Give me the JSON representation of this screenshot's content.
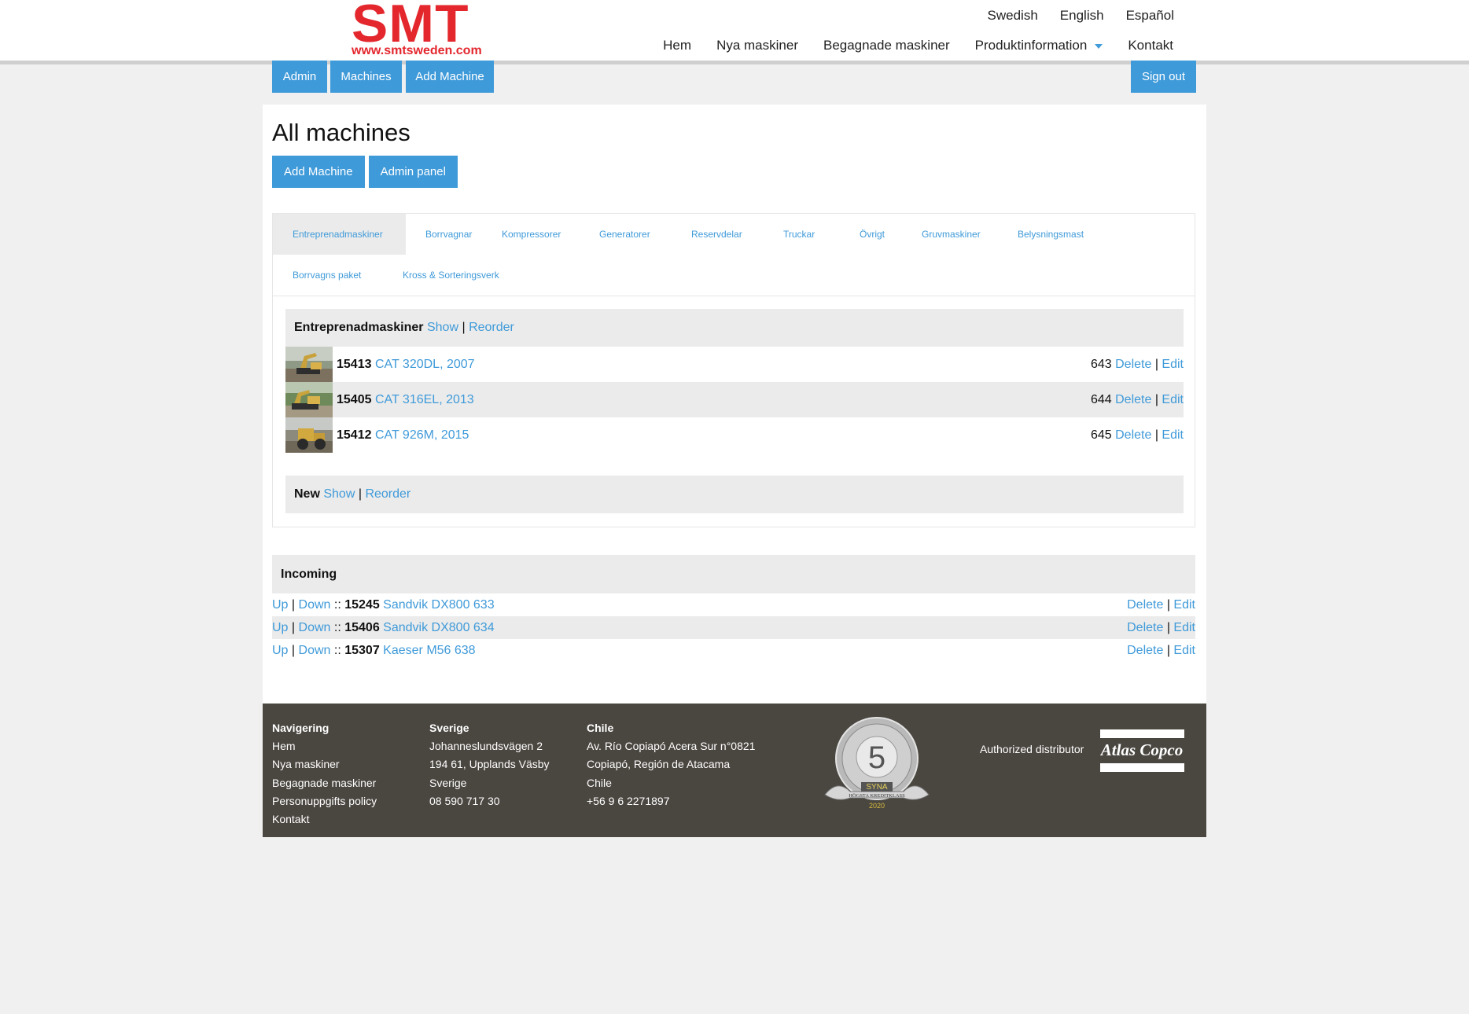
{
  "logo": {
    "name": "SMT",
    "url": "www.smtsweden.com"
  },
  "header": {
    "languages": [
      "Swedish",
      "English",
      "Español"
    ],
    "nav": [
      "Hem",
      "Nya maskiner",
      "Begagnade maskiner",
      "Produktinformation",
      "Kontakt"
    ]
  },
  "adminbar": {
    "admin": "Admin",
    "machines": "Machines",
    "add_machine": "Add Machine",
    "sign_out": "Sign out"
  },
  "page": {
    "title": "All machines",
    "add_machine": "Add Machine",
    "admin_panel": "Admin panel"
  },
  "tabs": [
    "Entreprenadmaskiner",
    "Borrvagnar",
    "Kompressorer",
    "Generatorer",
    "Reservdelar",
    "Truckar",
    "Övrigt",
    "Gruvmaskiner",
    "Belysningsmast",
    "Borrvagns paket",
    "Kross & Sorteringsverk"
  ],
  "category": {
    "name": "Entreprenadmaskiner",
    "show": "Show",
    "sep": "|",
    "reorder": "Reorder",
    "machines": [
      {
        "id": "15413",
        "title": "CAT 320DL, 2007",
        "order": "643",
        "delete": "Delete",
        "edit": "Edit"
      },
      {
        "id": "15405",
        "title": "CAT 316EL, 2013",
        "order": "644",
        "delete": "Delete",
        "edit": "Edit"
      },
      {
        "id": "15412",
        "title": "CAT 926M, 2015",
        "order": "645",
        "delete": "Delete",
        "edit": "Edit"
      }
    ]
  },
  "new_category": {
    "name": "New",
    "show": "Show",
    "reorder": "Reorder"
  },
  "incoming": {
    "title": "Incoming",
    "up": "Up",
    "down": "Down",
    "sep2": "::",
    "items": [
      {
        "id": "15245",
        "title": "Sandvik DX800 633",
        "delete": "Delete",
        "edit": "Edit"
      },
      {
        "id": "15406",
        "title": "Sandvik DX800 634",
        "delete": "Delete",
        "edit": "Edit"
      },
      {
        "id": "15307",
        "title": "Kaeser M56 638",
        "delete": "Delete",
        "edit": "Edit"
      }
    ]
  },
  "footer": {
    "nav_title": "Navigering",
    "nav_links": [
      "Hem",
      "Nya maskiner",
      "Begagnade maskiner",
      "Personuppgifts policy",
      "Kontakt"
    ],
    "sweden_title": "Sverige",
    "sweden_lines": [
      "Johanneslundsvägen 2",
      "194 61, Upplands Väsby",
      "Sverige",
      "08 590 717 30"
    ],
    "chile_title": "Chile",
    "chile_lines": [
      "Av. Río Copiapó Acera Sur n°0821",
      "Copiapó, Región de Atacama",
      "Chile",
      "+56 9 6 2271897"
    ],
    "badge": {
      "number": "5",
      "brand": "SYNA",
      "text": "HÖGSTA KREDITKLASS",
      "year": "2020"
    },
    "authorized": "Authorized distributor",
    "atlas": "Atlas Copco"
  },
  "colors": {
    "accent": "#3f9ad9",
    "logo": "#e3272d",
    "footer_bg": "#4a4640"
  }
}
